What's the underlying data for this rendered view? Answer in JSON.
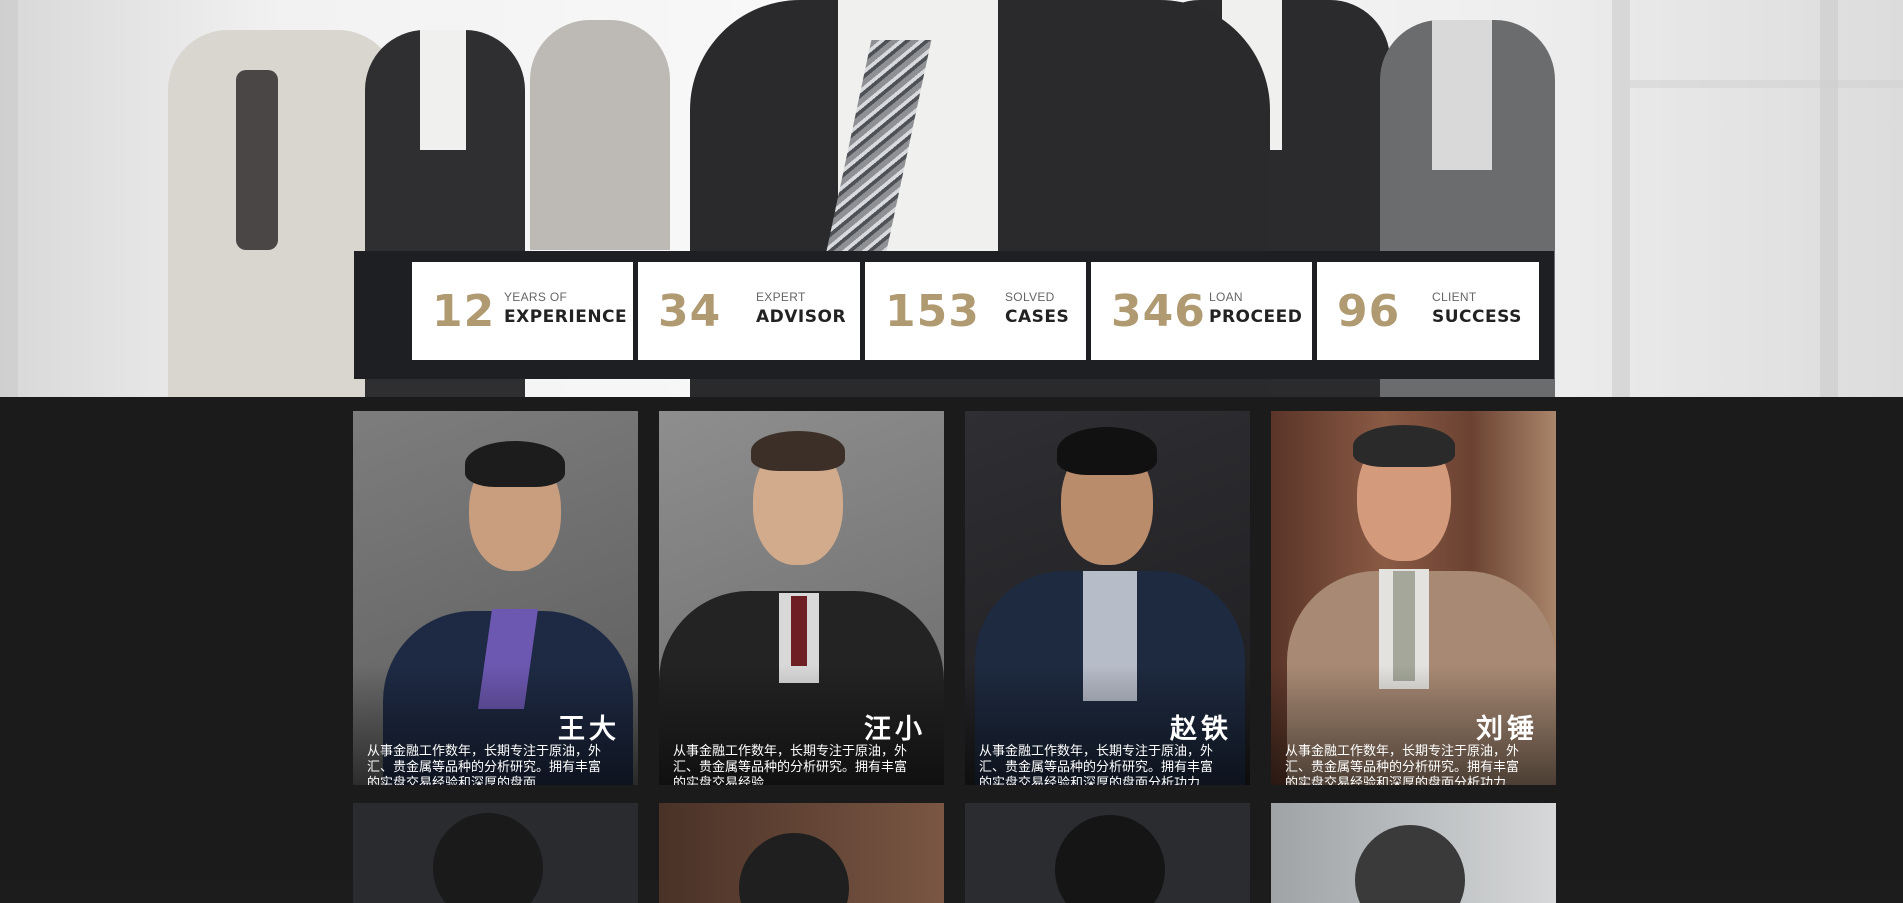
{
  "stats": [
    {
      "number": "12",
      "small": "YEARS OF",
      "big": "EXPERIENCE"
    },
    {
      "number": "34",
      "small": "EXPERT",
      "big": "ADVISOR"
    },
    {
      "number": "153",
      "small": "SOLVED",
      "big": "CASES"
    },
    {
      "number": "346",
      "small": "LOAN",
      "big": "PROCEED"
    },
    {
      "number": "96",
      "small": "CLIENT",
      "big": "SUCCESS"
    }
  ],
  "team": [
    {
      "name": "王大",
      "description": "从事金融工作数年，长期专注于原油，外\n汇、贵金属等品种的分析研究。拥有丰富\n的实盘交易经验和深厚的盘面...."
    },
    {
      "name": "汪小",
      "description": "从事金融工作数年，长期专注于原油，外\n汇、贵金属等品种的分析研究。拥有丰富\n的实盘交易经验..."
    },
    {
      "name": "赵铁",
      "description": "从事金融工作数年，长期专注于原油，外\n汇、贵金属等品种的分析研究。拥有丰富\n的实盘交易经验和深厚的盘面分析功力"
    },
    {
      "name": "刘锤",
      "description": "从事金融工作数年，长期专注于原油，外\n汇、贵金属等品种的分析研究。拥有丰富\n的实盘交易经验和深厚的盘面分析功力"
    }
  ],
  "colors": {
    "accent": "#b09a72",
    "dark": "#1c1c1c",
    "card_text": "#ffffff"
  }
}
